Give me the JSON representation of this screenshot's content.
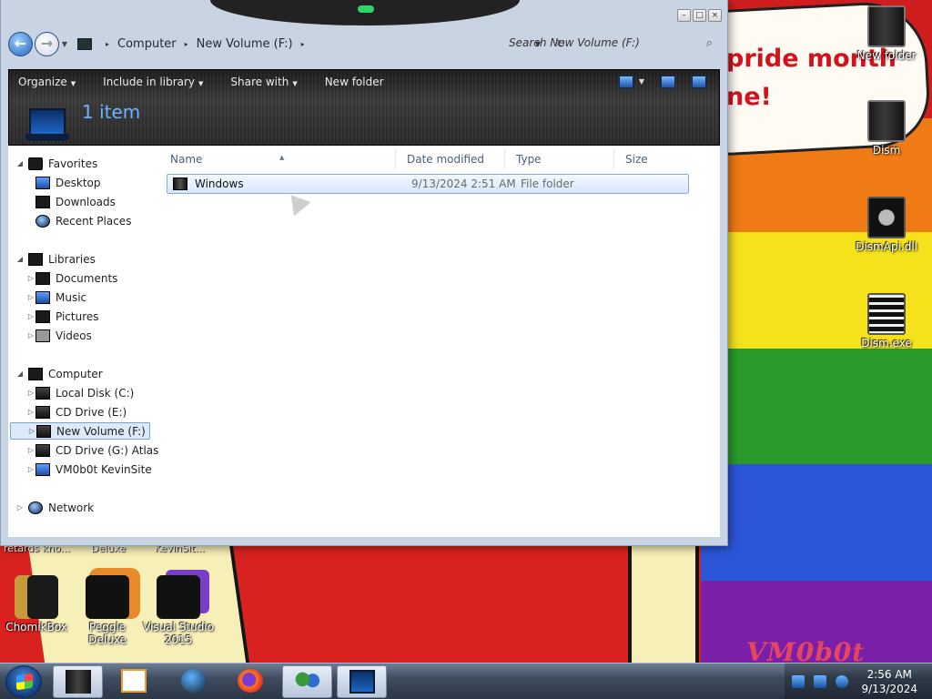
{
  "wallpaper": {
    "banner_text": "pride month",
    "banner_text2": "ne!",
    "watermark": "VM0b0t",
    "cut_labels": [
      "retards kno...",
      "Deluxe",
      "KevinSit..."
    ]
  },
  "desktop_icons": [
    {
      "label": "New folder"
    },
    {
      "label": "Dism"
    },
    {
      "label": "DismApi.dll"
    },
    {
      "label": "Dism.exe"
    }
  ],
  "left_desktop_icons": [
    {
      "label": "ChomikBox"
    },
    {
      "label": "Peggle Deluxe"
    },
    {
      "label": "Visual Studio 2015"
    }
  ],
  "window": {
    "controls": {
      "minimize": "–",
      "maximize": "□",
      "close": "×"
    },
    "nav": {
      "back": "←",
      "forward": "→",
      "dropdown": "▼"
    },
    "breadcrumb": [
      "Computer",
      "New Volume (F:)"
    ],
    "breadcrumb_sep": "▸",
    "address_dropdown": "▼",
    "refresh": "↻",
    "search_placeholder": "Search New Volume (F:)",
    "search_icon": "⌕",
    "toolbar": {
      "organize": "Organize",
      "include_in_library": "Include in library",
      "share_with": "Share with",
      "new_folder": "New folder",
      "caret": "▼"
    },
    "item_count": "1 item",
    "nav_pane": {
      "favorites": {
        "label": "Favorites",
        "items": [
          "Desktop",
          "Downloads",
          "Recent Places"
        ]
      },
      "libraries": {
        "label": "Libraries",
        "items": [
          "Documents",
          "Music",
          "Pictures",
          "Videos"
        ]
      },
      "computer": {
        "label": "Computer",
        "items": [
          "Local Disk (C:)",
          "CD Drive (E:)",
          "New Volume (F:)",
          "CD Drive (G:) Atlas",
          "VM0b0t KevinSite"
        ]
      },
      "network": {
        "label": "Network"
      },
      "expanded_glyph": "◢",
      "collapsed_glyph": "▷"
    },
    "columns": [
      "Name",
      "Date modified",
      "Type",
      "Size"
    ],
    "sort_indicator": "▲",
    "files": [
      {
        "name": "Windows",
        "date_modified": "9/13/2024 2:51 AM",
        "type": "File folder",
        "size": ""
      }
    ]
  },
  "taskbar": {
    "time": "2:56 AM",
    "date": "9/13/2024"
  }
}
